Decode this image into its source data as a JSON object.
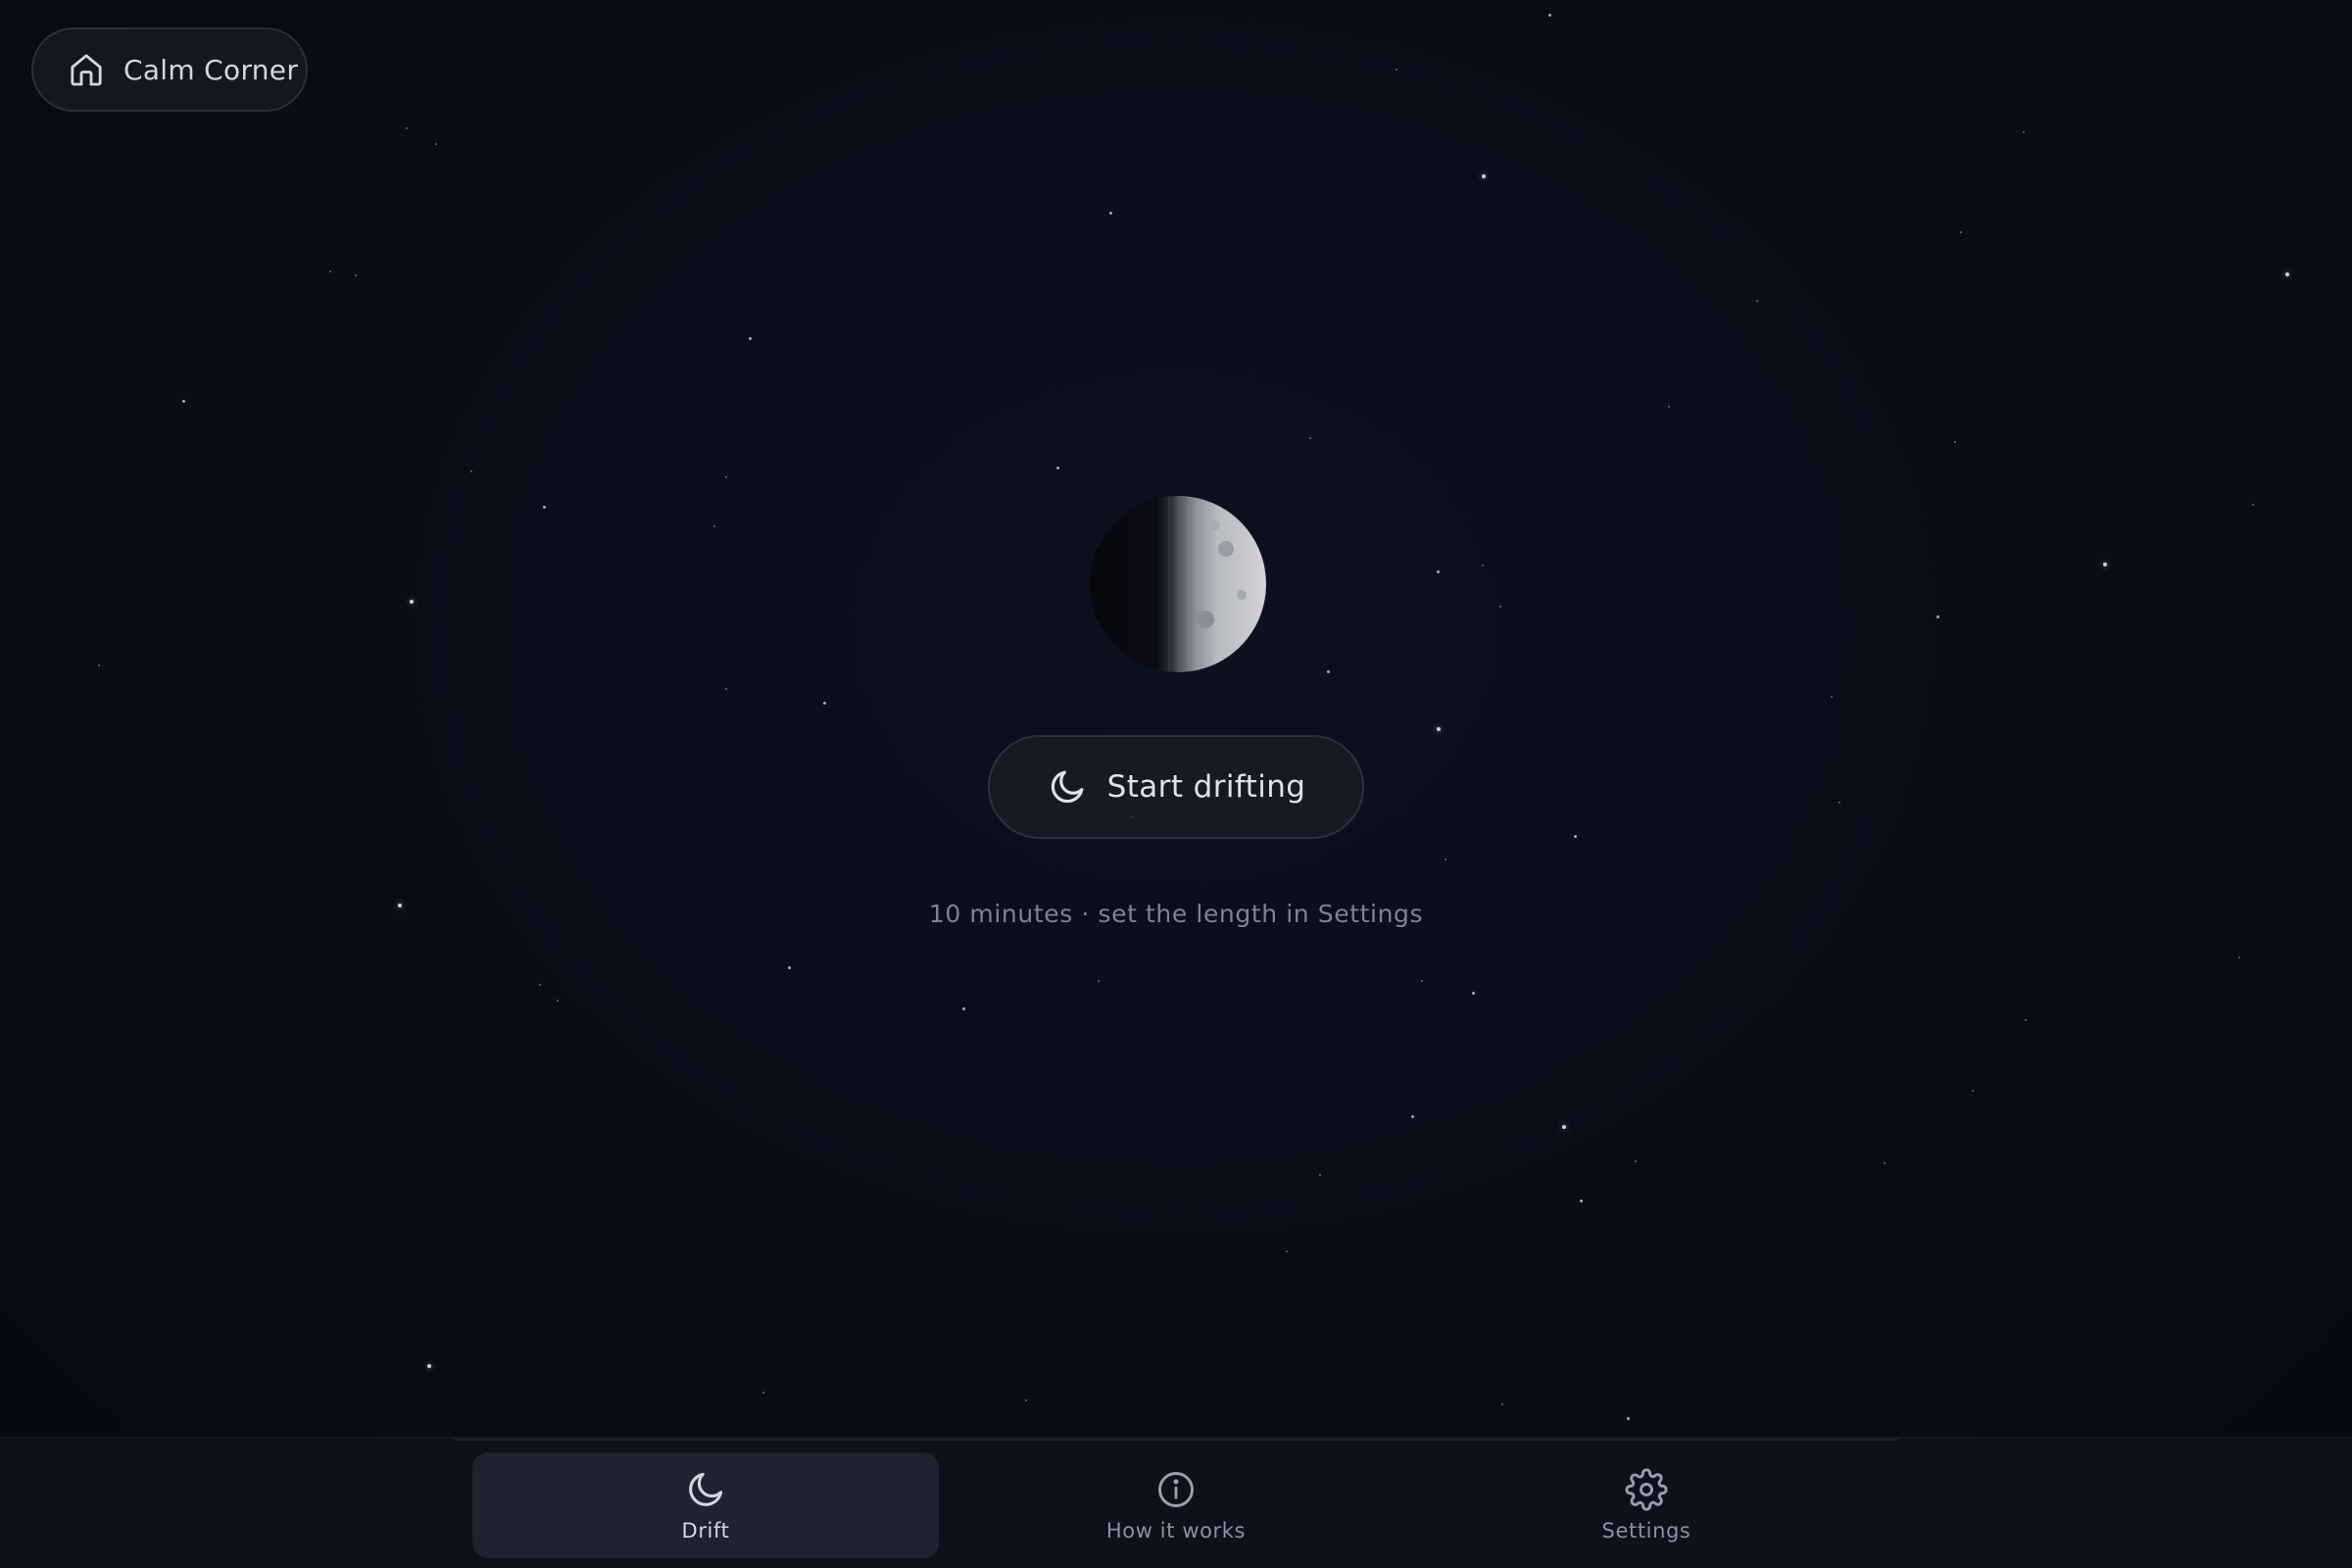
{
  "header": {
    "app_name": "Calm Corner",
    "icon": "home-icon"
  },
  "main": {
    "moon_icon": "half-moon-illustration",
    "start_button": {
      "label": "Start drifting",
      "icon": "crescent-moon-icon"
    },
    "hint": "10 minutes · set the length in Settings"
  },
  "nav": {
    "items": [
      {
        "label": "Drift",
        "icon": "crescent-moon-icon",
        "active": true
      },
      {
        "label": "How it works",
        "icon": "info-icon",
        "active": false
      },
      {
        "label": "Settings",
        "icon": "gear-icon",
        "active": false
      }
    ]
  },
  "colors": {
    "background": "#0a0c16",
    "surface": "#181b26",
    "text_primary": "#dfe2ec",
    "text_muted": "#7e8294",
    "star": "#d8dcec"
  }
}
